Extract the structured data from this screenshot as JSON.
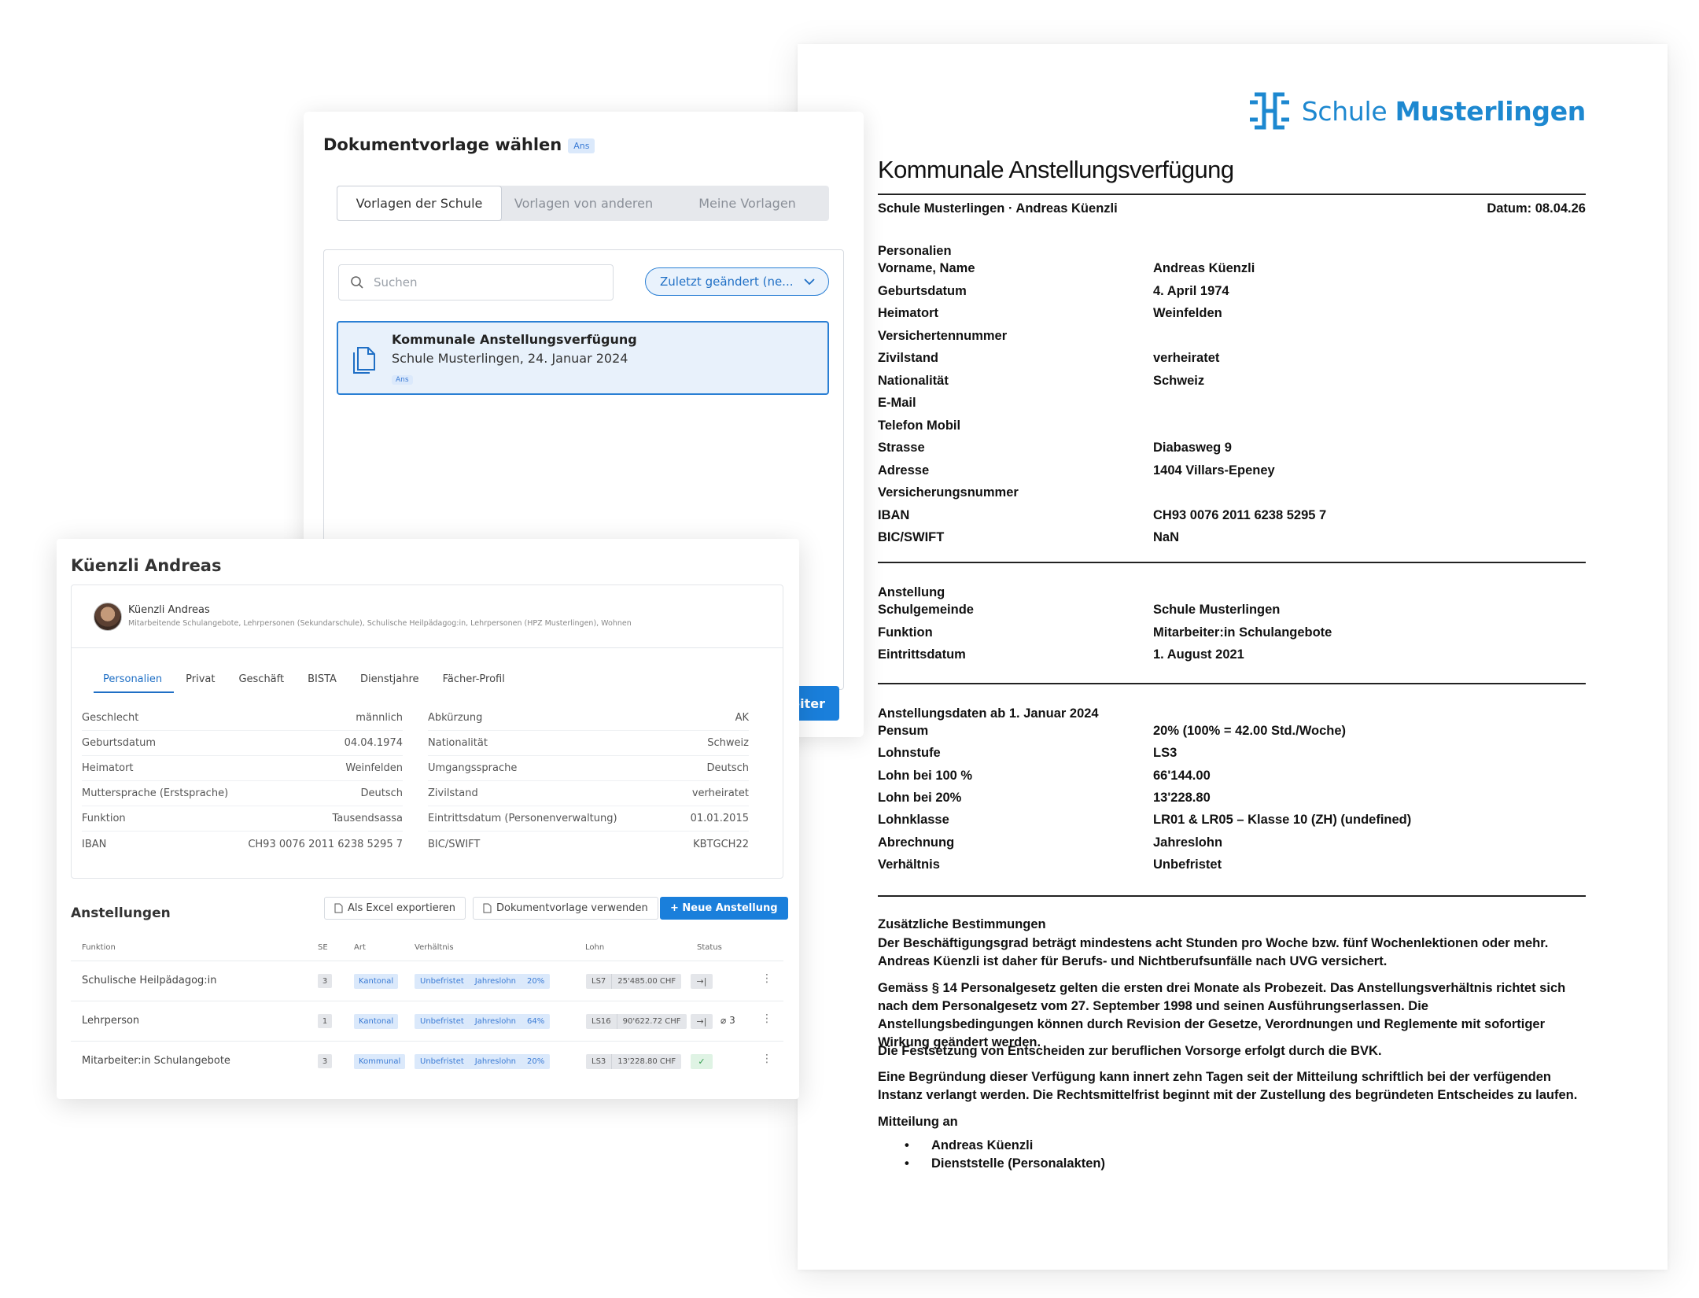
{
  "document": {
    "logo": {
      "prefix": "Schule",
      "bold": "Musterlingen"
    },
    "title": "Kommunale Anstellungsverfügung",
    "meta_left": "Schule Musterlingen · Andreas Küenzli",
    "meta_right": "Datum: 08.04.26",
    "personalien": {
      "heading": "Personalien",
      "rows": [
        {
          "k": "Vorname, Name",
          "v": "Andreas Küenzli"
        },
        {
          "k": "Geburtsdatum",
          "v": "4. April 1974"
        },
        {
          "k": "Heimatort",
          "v": "Weinfelden"
        },
        {
          "k": "Versichertennummer",
          "v": ""
        },
        {
          "k": "Zivilstand",
          "v": "verheiratet"
        },
        {
          "k": "Nationalität",
          "v": "Schweiz"
        },
        {
          "k": "E-Mail",
          "v": ""
        },
        {
          "k": "Telefon Mobil",
          "v": ""
        },
        {
          "k": "Strasse",
          "v": "Diabasweg 9"
        },
        {
          "k": "Adresse",
          "v": "1404 Villars-Epeney"
        },
        {
          "k": "Versicherungsnummer",
          "v": ""
        },
        {
          "k": "IBAN",
          "v": "CH93 0076 2011 6238 5295 7"
        },
        {
          "k": "BIC/SWIFT",
          "v": "NaN"
        }
      ]
    },
    "anstellung": {
      "heading": "Anstellung",
      "rows": [
        {
          "k": "Schulgemeinde",
          "v": "Schule Musterlingen"
        },
        {
          "k": "Funktion",
          "v": "Mitarbeiter:in Schulangebote"
        },
        {
          "k": "Eintrittsdatum",
          "v": "1. August 2021"
        }
      ]
    },
    "anstellungsdaten": {
      "heading": "Anstellungsdaten ab 1. Januar 2024",
      "rows": [
        {
          "k": "Pensum",
          "v": "20% (100% = 42.00 Std./Woche)"
        },
        {
          "k": "Lohnstufe",
          "v": "LS3"
        },
        {
          "k": "Lohn bei 100 %",
          "v": "66'144.00"
        },
        {
          "k": "Lohn bei 20%",
          "v": "13'228.80"
        },
        {
          "k": "Lohnklasse",
          "v": "LR01 & LR05 – Klasse 10 (ZH) (undefined)"
        },
        {
          "k": "Abrechnung",
          "v": "Jahreslohn"
        },
        {
          "k": "Verhältnis",
          "v": "Unbefristet"
        }
      ]
    },
    "zusaetzlich": {
      "heading": "Zusätzliche Bestimmungen",
      "p1": "Der Beschäftigungsgrad beträgt mindestens acht Stunden pro Woche bzw. fünf Wochenlektionen oder mehr. Andreas Küenzli ist daher für Berufs- und Nichtberufsunfälle nach UVG versichert.",
      "p2": "Gemäss § 14 Personalgesetz gelten die ersten drei Monate als Probezeit. Das Anstellungsverhältnis richtet sich nach dem Personalgesetz vom 27. September 1998 und seinen Ausführungserlassen. Die Anstellungsbedingungen können durch Revision der Gesetze, Verordnungen und Reglemente mit sofortiger Wirkung geändert werden.",
      "p3": "Die Festsetzung von Entscheiden zur beruflichen Vorsorge erfolgt durch die BVK.",
      "p4": "Eine Begründung dieser Verfügung kann innert zehn Tagen seit der Mitteilung schriftlich bei der verfügenden Instanz verlangt werden. Die Rechtsmittelfrist beginnt mit der Zustellung des begründeten Entscheides zu laufen.",
      "mitteilung": "Mitteilung an",
      "recipients": [
        "Andreas Küenzli",
        "Dienststelle (Personalakten)"
      ]
    }
  },
  "dialog": {
    "title": "Dokumentvorlage wählen",
    "badge": "Ans",
    "tabs": [
      "Vorlagen der Schule",
      "Vorlagen von anderen",
      "Meine Vorlagen"
    ],
    "search_placeholder": "Suchen",
    "sort_label": "Zuletzt geändert (ne...",
    "item": {
      "title": "Kommunale Anstellungsverfügung",
      "subtitle": "Schule Musterlingen, 24. Januar 2024",
      "badge": "Ans"
    },
    "next_button": "eiter"
  },
  "person": {
    "name": "Küenzli Andreas",
    "header_name": "Küenzli Andreas",
    "header_roles": "Mitarbeitende Schulangebote, Lehrpersonen (Sekundarschule), Schulische Heilpädagog:in, Lehrpersonen (HPZ Musterlingen), Wohnen",
    "tabs": [
      "Personalien",
      "Privat",
      "Geschäft",
      "BISTA",
      "Dienstjahre",
      "Fächer-Profil"
    ],
    "left": [
      {
        "k": "Geschlecht",
        "v": "männlich"
      },
      {
        "k": "Geburtsdatum",
        "v": "04.04.1974"
      },
      {
        "k": "Heimatort",
        "v": "Weinfelden"
      },
      {
        "k": "Muttersprache (Erstsprache)",
        "v": "Deutsch"
      },
      {
        "k": "Funktion",
        "v": "Tausendsassa"
      },
      {
        "k": "IBAN",
        "v": "CH93 0076 2011 6238 5295 7"
      }
    ],
    "right": [
      {
        "k": "Abkürzung",
        "v": "AK"
      },
      {
        "k": "Nationalität",
        "v": "Schweiz"
      },
      {
        "k": "Umgangssprache",
        "v": "Deutsch"
      },
      {
        "k": "Zivilstand",
        "v": "verheiratet"
      },
      {
        "k": "Eintrittsdatum (Personenverwaltung)",
        "v": "01.01.2015"
      },
      {
        "k": "BIC/SWIFT",
        "v": "KBTGCH22"
      }
    ],
    "anstellungen": {
      "title": "Anstellungen",
      "btn_excel": "Als Excel exportieren",
      "btn_template": "Dokumentvorlage verwenden",
      "btn_new": "+ Neue Anstellung",
      "columns": [
        "Funktion",
        "SE",
        "Art",
        "Verhältnis",
        "Lohn",
        "Status"
      ],
      "rows": [
        {
          "funktion": "Schulische Heilpädagog:in",
          "se": "3",
          "art": "Kantonal",
          "verh": "Unbefristet",
          "abr": "Jahreslohn",
          "pct": "20%",
          "ls": "LS7",
          "lohn": "25'485.00 CHF",
          "status": "→|",
          "extra": ""
        },
        {
          "funktion": "Lehrperson",
          "se": "1",
          "art": "Kantonal",
          "verh": "Unbefristet",
          "abr": "Jahreslohn",
          "pct": "64%",
          "ls": "LS16",
          "lohn": "90'622.72 CHF",
          "status": "→|",
          "extra": "3"
        },
        {
          "funktion": "Mitarbeiter:in Schulangebote",
          "se": "3",
          "art": "Kommunal",
          "verh": "Unbefristet",
          "abr": "Jahreslohn",
          "pct": "20%",
          "ls": "LS3",
          "lohn": "13'228.80 CHF",
          "status": "✓",
          "extra": ""
        }
      ]
    }
  },
  "colors": {
    "accent": "#1a7fdb",
    "brand": "#1d88d0",
    "tag_bg": "#dbe9fb"
  },
  "icons": [
    "logo-icon",
    "search-icon",
    "chevron-down-icon",
    "document-icon",
    "excel-icon",
    "file-icon",
    "paperclip-icon",
    "more-icon",
    "check-icon",
    "arrow-to-end-icon"
  ]
}
